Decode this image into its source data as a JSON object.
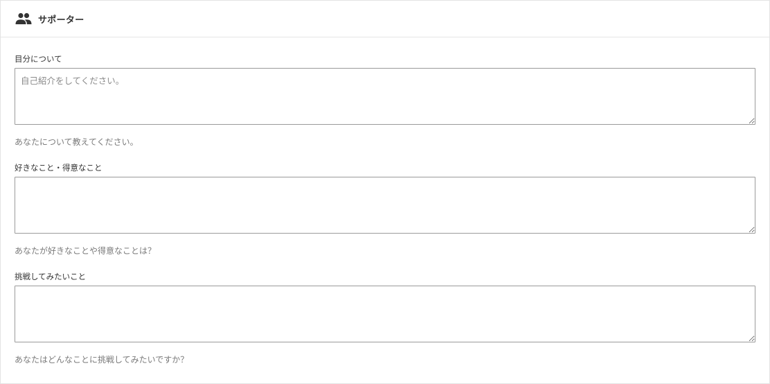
{
  "header": {
    "icon": "people-icon",
    "title": "サポーター"
  },
  "fields": [
    {
      "label": "目分について",
      "placeholder": "自己紹介をしてください。",
      "value": "",
      "help": "あなたについて教えてください。"
    },
    {
      "label": "好きなこと・得意なこと",
      "placeholder": "",
      "value": "",
      "help": "あなたが好きなことや得意なことは？"
    },
    {
      "label": "挑戦してみたいこと",
      "placeholder": "",
      "value": "",
      "help": "あなたはどんなことに挑戦してみたいですか？"
    }
  ]
}
